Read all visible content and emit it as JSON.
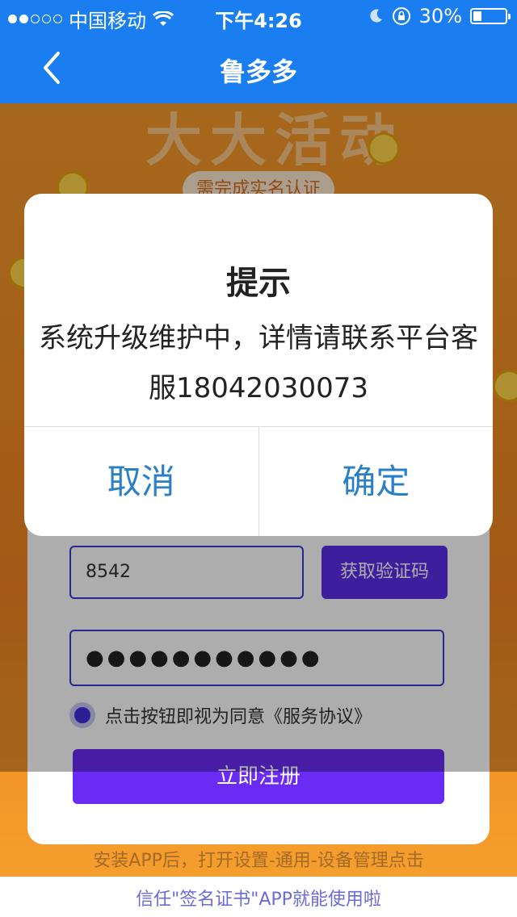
{
  "status_bar": {
    "carrier": "中国移动",
    "time": "下午4:26",
    "battery_percent": "30%",
    "battery_level": 0.3
  },
  "nav": {
    "title": "鲁多多",
    "back_icon": "chevron-left-icon"
  },
  "background": {
    "verify_pill": "需完成实名认证",
    "code_value": "8542",
    "get_code_button": "获取验证码",
    "password_mask": "●●●●●●●●●●●",
    "agree_text": "点击按钮即视为同意《服务协议》",
    "register_button": "立即注册",
    "footer_line1": "安装APP后，打开设置-通用-设备管理点击",
    "footer_line2": "信任\"签名证书\"APP就能使用啦"
  },
  "dialog": {
    "title": "提示",
    "message": "系统升级维护中，详情请联系平台客服18042030073",
    "cancel": "取消",
    "confirm": "确定"
  },
  "colors": {
    "nav_blue": "#1a7ef0",
    "dialog_button": "#2a7fc7",
    "purple_button": "#6a2cf5",
    "orange_bg": "#f08420"
  }
}
